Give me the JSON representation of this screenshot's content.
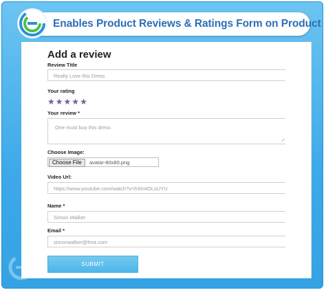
{
  "banner": {
    "title": "Enables Product Reviews & Ratings Form on Product pages"
  },
  "form": {
    "heading": "Add a review",
    "review_title": {
      "label": "Review Title",
      "placeholder": "Really Love this Dress"
    },
    "rating": {
      "label": "Your rating",
      "stars": 5,
      "star_glyph": "★",
      "star_color": "#7c5a96"
    },
    "review": {
      "label": "Your review *",
      "placeholder": "One must buy this dress"
    },
    "image": {
      "label": "Choose Image:",
      "button_label": "Choose File",
      "file_name": "avatar-80x80.png"
    },
    "video": {
      "label": "Video Url:",
      "placeholder": "https://www.youtube.com/watch?v=hSlmlOLsUYU"
    },
    "name": {
      "label": "Name *",
      "placeholder": "Simon Walker"
    },
    "email": {
      "label": "Email *",
      "placeholder": "simonwalker@fma.com"
    },
    "submit_label": "SUBMIT"
  },
  "colors": {
    "background_top": "#6cc4f1",
    "background_bottom": "#35a2e3",
    "brand_text": "#2a6fb6",
    "submit": "#5bbcec"
  }
}
